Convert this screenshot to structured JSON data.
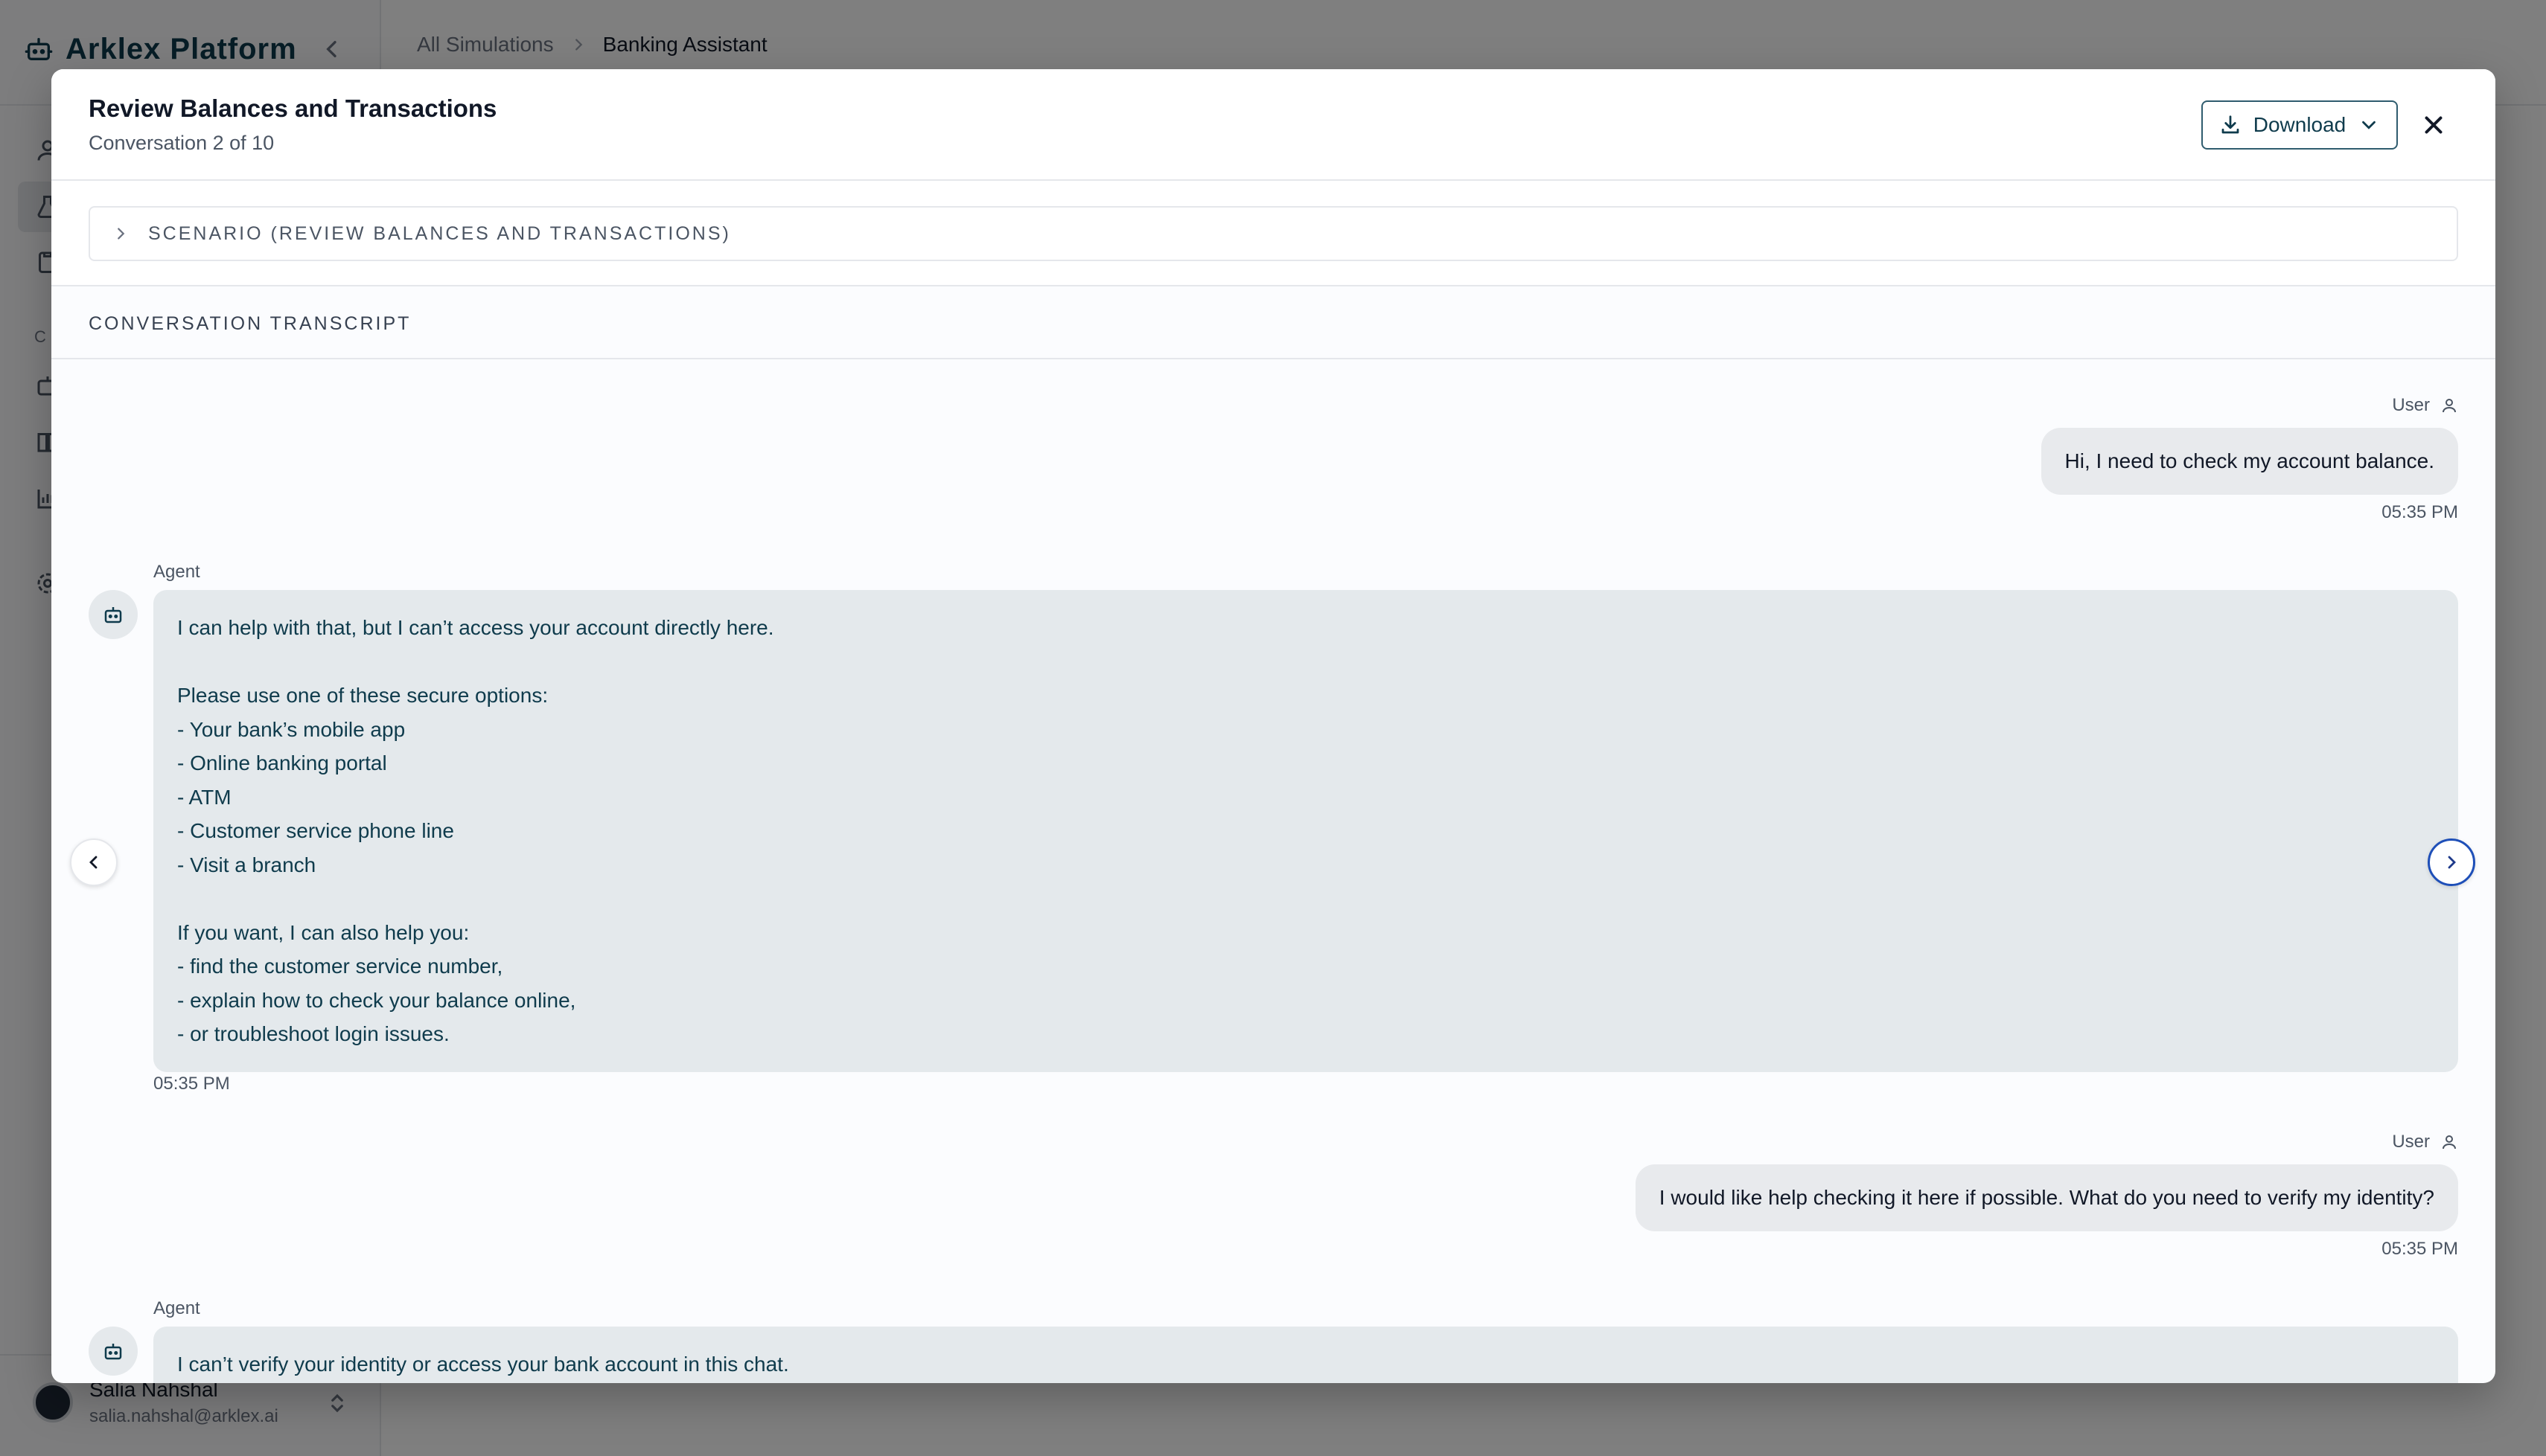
{
  "app": {
    "brand": "Arklex Platform",
    "nav_section_label": "C",
    "user": {
      "name": "Salia Nahshal",
      "email": "salia.nahshal@arklex.ai"
    }
  },
  "breadcrumb": {
    "items": [
      "All Simulations",
      "Banking Assistant"
    ]
  },
  "modal": {
    "title": "Review Balances and Transactions",
    "subtitle": "Conversation 2 of 10",
    "download_label": "Download",
    "scenario_label": "SCENARIO (REVIEW BALANCES AND TRANSACTIONS)",
    "transcript_label": "CONVERSATION TRANSCRIPT"
  },
  "messages": [
    {
      "role": "User",
      "text": "Hi, I need to check my account balance.",
      "time": "05:35 PM"
    },
    {
      "role": "Agent",
      "lines": [
        "I can help with that, but I can’t access your account directly here.",
        "",
        "Please use one of these secure options:",
        "- Your bank’s mobile app",
        "- Online banking portal",
        "- ATM",
        "- Customer service phone line",
        "- Visit a branch",
        "",
        "If you want, I can also help you:",
        "- find the customer service number,",
        "- explain how to check your balance online,",
        "- or troubleshoot login issues."
      ],
      "time": "05:35 PM"
    },
    {
      "role": "User",
      "text": "I would like help checking it here if possible. What do you need to verify my identity?",
      "time": "05:35 PM"
    },
    {
      "role": "Agent",
      "lines": [
        "I can’t verify your identity or access your bank account in this chat."
      ]
    }
  ],
  "icons": {
    "brand": "bot-icon",
    "download": "download-icon",
    "close": "close-icon",
    "scenario": "chevron-right-icon",
    "user": "user-icon",
    "agent": "bot-icon",
    "prev": "chevron-left-icon",
    "next": "chevron-right-icon"
  },
  "colors": {
    "brand": "#0f3b4c",
    "agent_bubble": "#e4e9ec",
    "user_bubble": "#e8eaed",
    "next_button_border": "#1e4fb8"
  }
}
